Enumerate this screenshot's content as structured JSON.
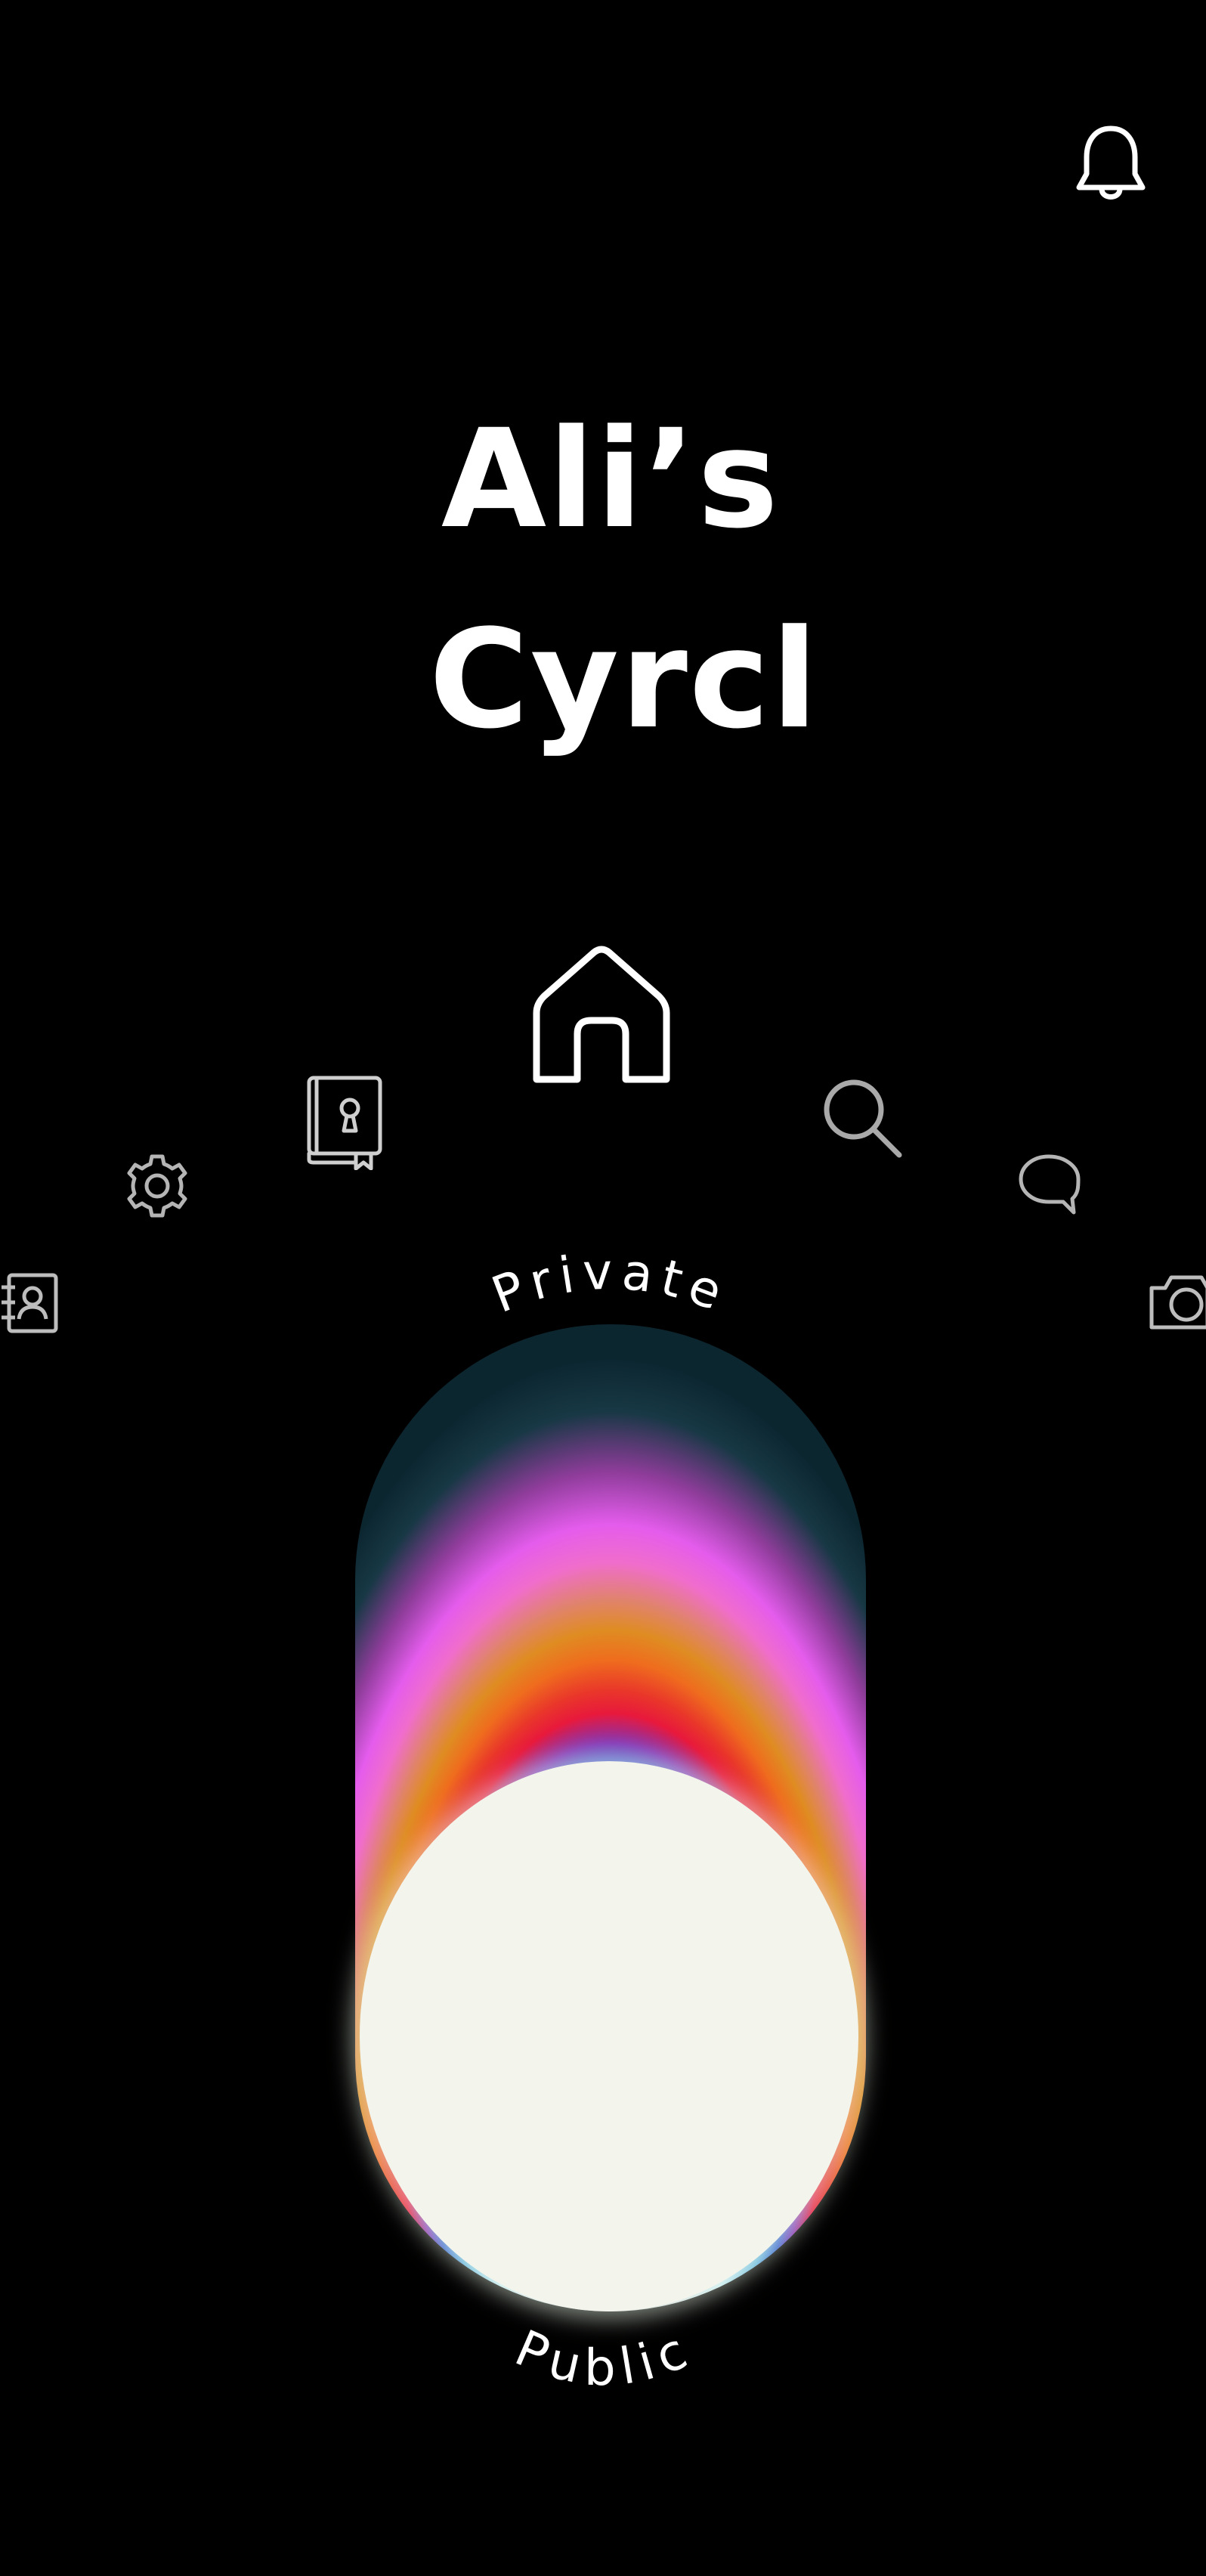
{
  "title": {
    "line1": "Ali’s",
    "line2": "Cyrcl"
  },
  "icons": {
    "notifications": "bell-icon",
    "home": "home-icon",
    "private_journal": "locked-book-icon",
    "search": "search-icon",
    "settings": "gear-icon",
    "messages": "chat-bubble-icon",
    "contacts": "contact-card-icon",
    "camera": "camera-icon"
  },
  "privacy_toggle": {
    "top_label": "Private",
    "bottom_label": "Public",
    "state": "Public"
  },
  "colors": {
    "background": "#000000",
    "foreground": "#ffffff",
    "knob": "#f3f5ed",
    "gradient": [
      "#0c2630",
      "#e45cec",
      "#df8c22",
      "#e8193c",
      "#2f5fd0",
      "#c7edf6"
    ]
  }
}
